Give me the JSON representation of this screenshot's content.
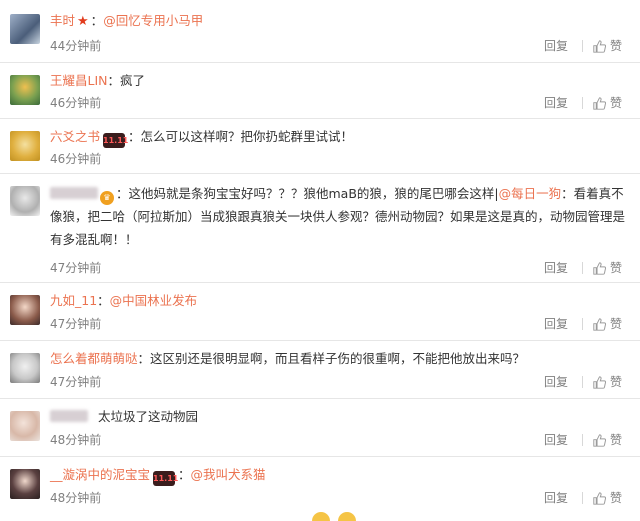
{
  "actions": {
    "reply": "回复",
    "like": "赞"
  },
  "comments": [
    {
      "user": "丰时",
      "mention": "@回忆专用小马甲",
      "content": "",
      "time": "44分钟前"
    },
    {
      "user": "王耀昌LIN",
      "content": "：疯了",
      "time": "46分钟前"
    },
    {
      "user": "六爻之书",
      "badge": "11.11",
      "content": "：怎么可以这样啊？把你扔蛇群里试试！",
      "time": "46分钟前"
    },
    {
      "user": "",
      "content_a": "：这他妈就是条狗宝宝好吗？？？狼他maB的狼，狼的尾巴哪会这样|",
      "mention": "@每日一狗",
      "content_b": "：看着真不像狼，把二哈（阿拉斯加）当成狼跟真狼关一块供人参观？德州动物园？如果是这是真的，动物园管理是有多混乱啊！！",
      "time": "47分钟前"
    },
    {
      "user": "九如_11",
      "mention": "@中国林业发布",
      "content": "：",
      "time": "47分钟前"
    },
    {
      "user": "怎么着都萌萌哒",
      "content": "：这区别还是很明显啊，而且看样子伤的很重啊，不能把他放出来吗？",
      "time": "47分钟前"
    },
    {
      "user": "",
      "content": "太垃圾了这动物园",
      "time": "48分钟前"
    },
    {
      "user": "__漩涡中的泥宝宝",
      "badge": "11.11",
      "mention": "@我叫犬系猫",
      "content": "：",
      "time": "48分钟前"
    }
  ],
  "colors": {
    "username": "#eb7350",
    "text": "#333333",
    "meta": "#808080"
  }
}
